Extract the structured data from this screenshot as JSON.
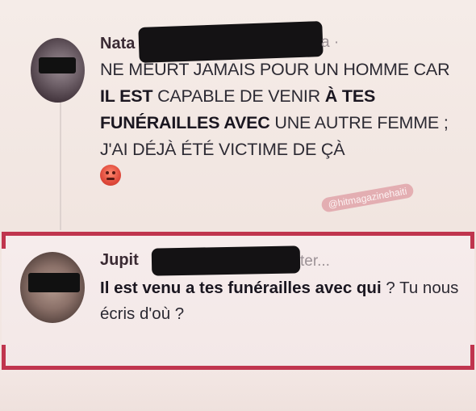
{
  "post": {
    "author_visible": "Nata",
    "author_trail": "a ·",
    "text_parts": [
      {
        "text": "NE MEURT JAMAIS POUR UN HOMME CAR ",
        "bold": false
      },
      {
        "text": "IL EST",
        "bold": true
      },
      {
        "text": " CAPABLE DE VENIR ",
        "bold": false
      },
      {
        "text": "À TES FUNÉRAILLES AVEC",
        "bold": true
      },
      {
        "text": " UNE AUTRE FEMME ; J'AI DÉJÀ ÉTÉ VICTIME DE ÇÀ",
        "bold": false
      }
    ],
    "reaction_icon": "angry-face-emoji",
    "watermark": "@hitmagazinehaiti"
  },
  "reply": {
    "author_visible": "Jupit",
    "author_trail": "ter...",
    "text_parts": [
      {
        "text": "Il est venu a tes funérailles avec qui",
        "bold": true
      },
      {
        "text": " ? Tu nous écris d'où ?",
        "bold": false
      }
    ]
  },
  "colors": {
    "accent_frame": "#c0354e",
    "watermark_bg": "#e2a8ad",
    "background": "#f3e9e4"
  }
}
